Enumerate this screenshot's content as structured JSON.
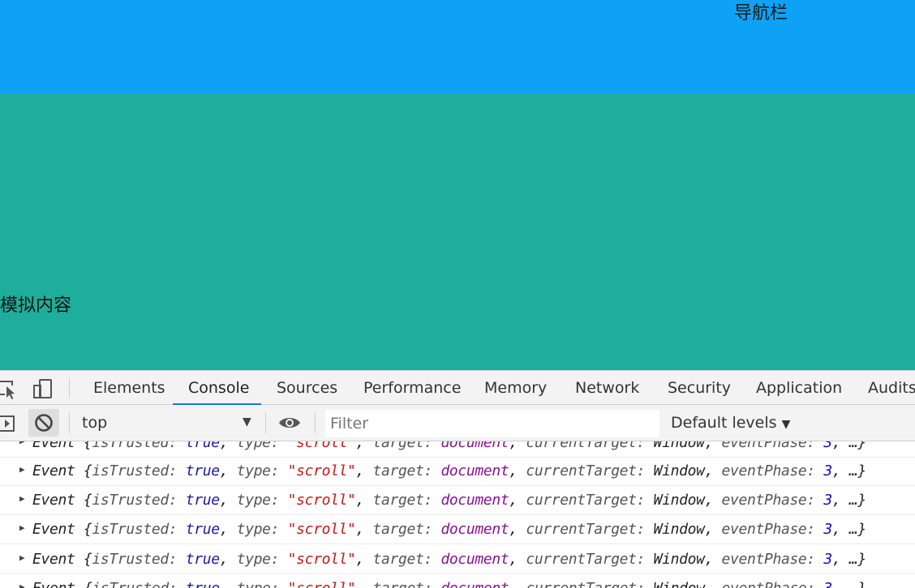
{
  "page": {
    "navbar_label": "导航栏",
    "content_label": "模拟内容"
  },
  "devtools": {
    "tabs": [
      {
        "label": "Elements",
        "active": false
      },
      {
        "label": "Console",
        "active": true
      },
      {
        "label": "Sources",
        "active": false
      },
      {
        "label": "Performance",
        "active": false
      },
      {
        "label": "Memory",
        "active": false
      },
      {
        "label": "Network",
        "active": false
      },
      {
        "label": "Security",
        "active": false
      },
      {
        "label": "Application",
        "active": false
      },
      {
        "label": "Audits",
        "active": false
      }
    ],
    "toolbar": {
      "context": "top",
      "filter_placeholder": "Filter",
      "levels": "Default levels"
    },
    "log": {
      "entry": {
        "name": "Event",
        "open": " {",
        "k1": "isTrusted: ",
        "v1": "true",
        "k2": "type: ",
        "v2": "\"scroll\"",
        "k3": "target: ",
        "v3": "document",
        "k4": "currentTarget: ",
        "v4": "Window",
        "k5": "eventPhase: ",
        "v5": "3",
        "tail": "…}",
        "comma": ", "
      },
      "row_count": 6
    }
  },
  "colors": {
    "navbar_bg": "#0da2f5",
    "content_bg": "#1fae9b",
    "active_tab_underline": "#1a73e8"
  }
}
